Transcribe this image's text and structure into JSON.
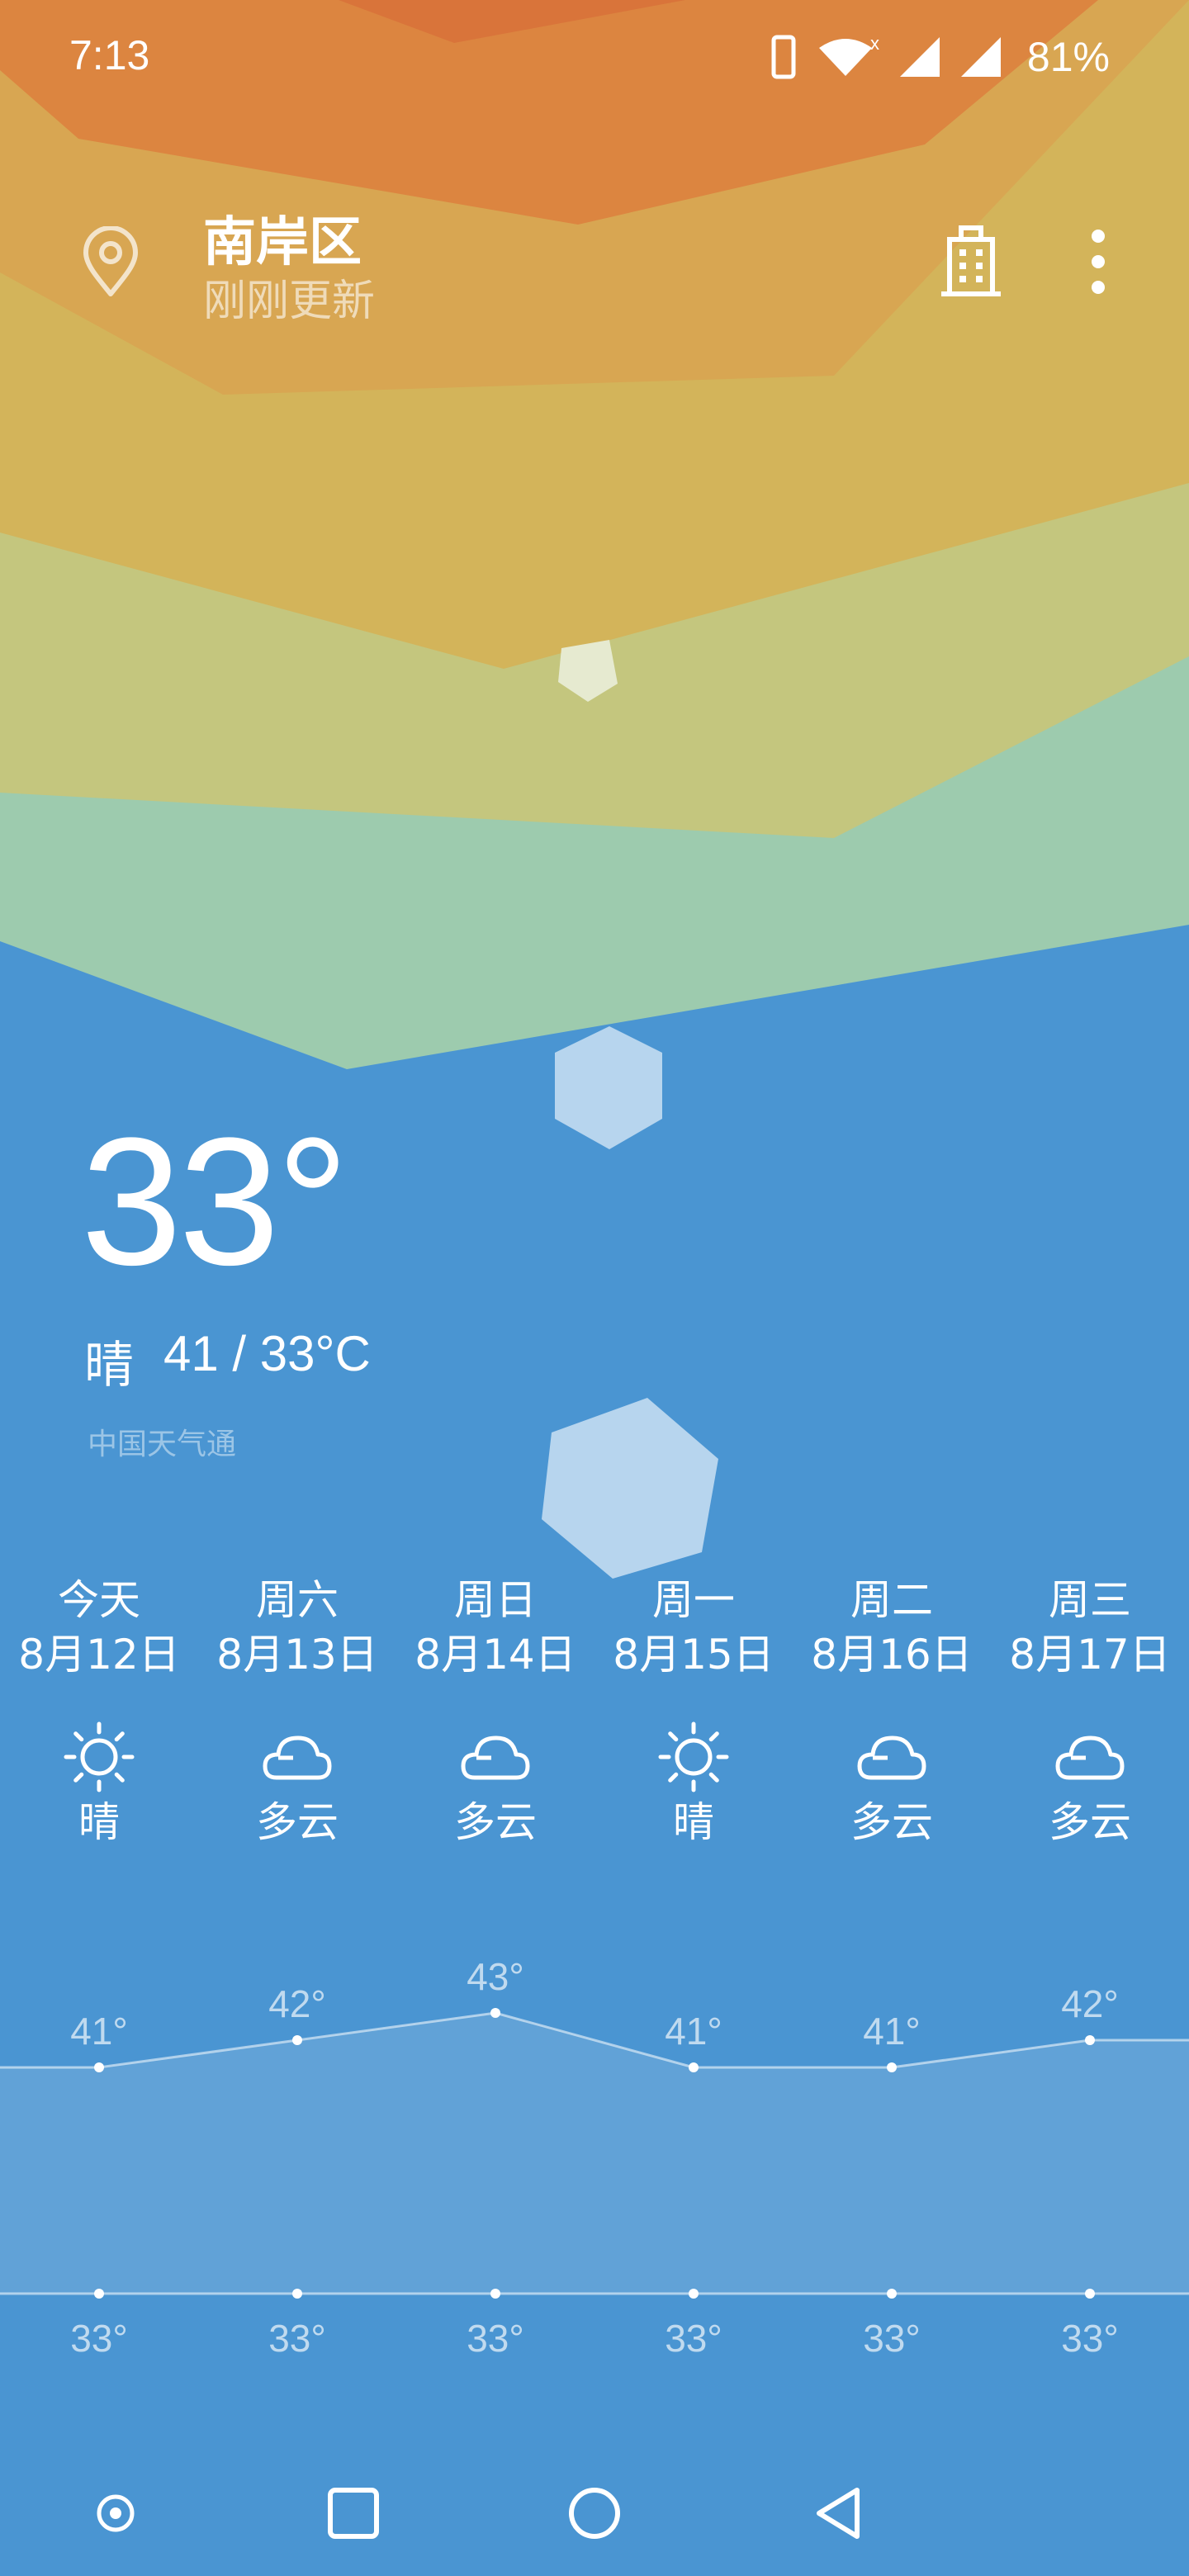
{
  "status_bar": {
    "time": "7:13",
    "battery": "81%"
  },
  "header": {
    "city": "南岸区",
    "update_status": "刚刚更新"
  },
  "current": {
    "temperature": "33°",
    "condition": "晴",
    "range": "41 / 33°C",
    "source": "中国天气通"
  },
  "forecast": [
    {
      "day": "今天",
      "date": "8月12日",
      "icon": "sun-icon",
      "condition": "晴",
      "high": "41°",
      "low": "33°"
    },
    {
      "day": "周六",
      "date": "8月13日",
      "icon": "cloud-icon",
      "condition": "多云",
      "high": "42°",
      "low": "33°"
    },
    {
      "day": "周日",
      "date": "8月14日",
      "icon": "cloud-icon",
      "condition": "多云",
      "high": "43°",
      "low": "33°"
    },
    {
      "day": "周一",
      "date": "8月15日",
      "icon": "sun-icon",
      "condition": "晴",
      "high": "41°",
      "low": "33°"
    },
    {
      "day": "周二",
      "date": "8月16日",
      "icon": "cloud-icon",
      "condition": "多云",
      "high": "41°",
      "low": "33°"
    },
    {
      "day": "周三",
      "date": "8月17日",
      "icon": "cloud-icon",
      "condition": "多云",
      "high": "42°",
      "low": "33°"
    }
  ],
  "chart_data": {
    "type": "line",
    "categories": [
      "今天",
      "周六",
      "周日",
      "周一",
      "周二",
      "周三"
    ],
    "series": [
      {
        "values": [
          41,
          42,
          43,
          41,
          41,
          42
        ]
      },
      {
        "values": [
          33,
          33,
          33,
          33,
          33,
          33
        ]
      }
    ]
  },
  "colors": {
    "sky_blue": "#4a95d2",
    "band_orange": "#dc8540",
    "band_yellow": "#d3b45a",
    "band_olive": "#c4c67e",
    "band_green": "#9dcbae"
  }
}
